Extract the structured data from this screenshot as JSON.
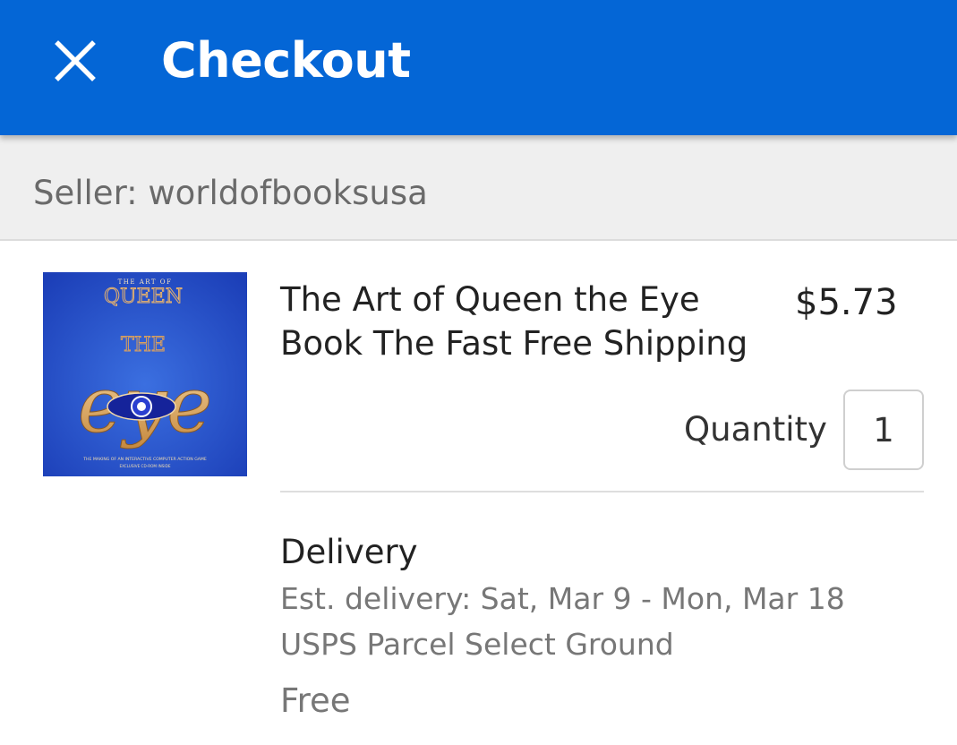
{
  "header": {
    "title": "Checkout",
    "close_icon": "close-icon",
    "background_color": "#0466d6"
  },
  "seller": {
    "label": "Seller: worldofbooksusa"
  },
  "item": {
    "image_icon": "book-cover-image",
    "cover_text": {
      "top": "THE ART OF",
      "queen": "QUEEN",
      "the": "THE",
      "eye": "eye",
      "sub1": "THE MAKING OF AN INTERACTIVE COMPUTER ACTION GAME",
      "sub2": "EXCLUSIVE CD-ROM INSIDE"
    },
    "title": "The Art of Queen the Eye Book The Fast Free Shipping",
    "price": "$5.73",
    "quantity_label": "Quantity",
    "quantity_value": "1"
  },
  "delivery": {
    "heading": "Delivery",
    "estimate": "Est. delivery: Sat, Mar 9 - Mon, Mar 18",
    "service": "USPS Parcel Select Ground",
    "cost": "Free"
  }
}
